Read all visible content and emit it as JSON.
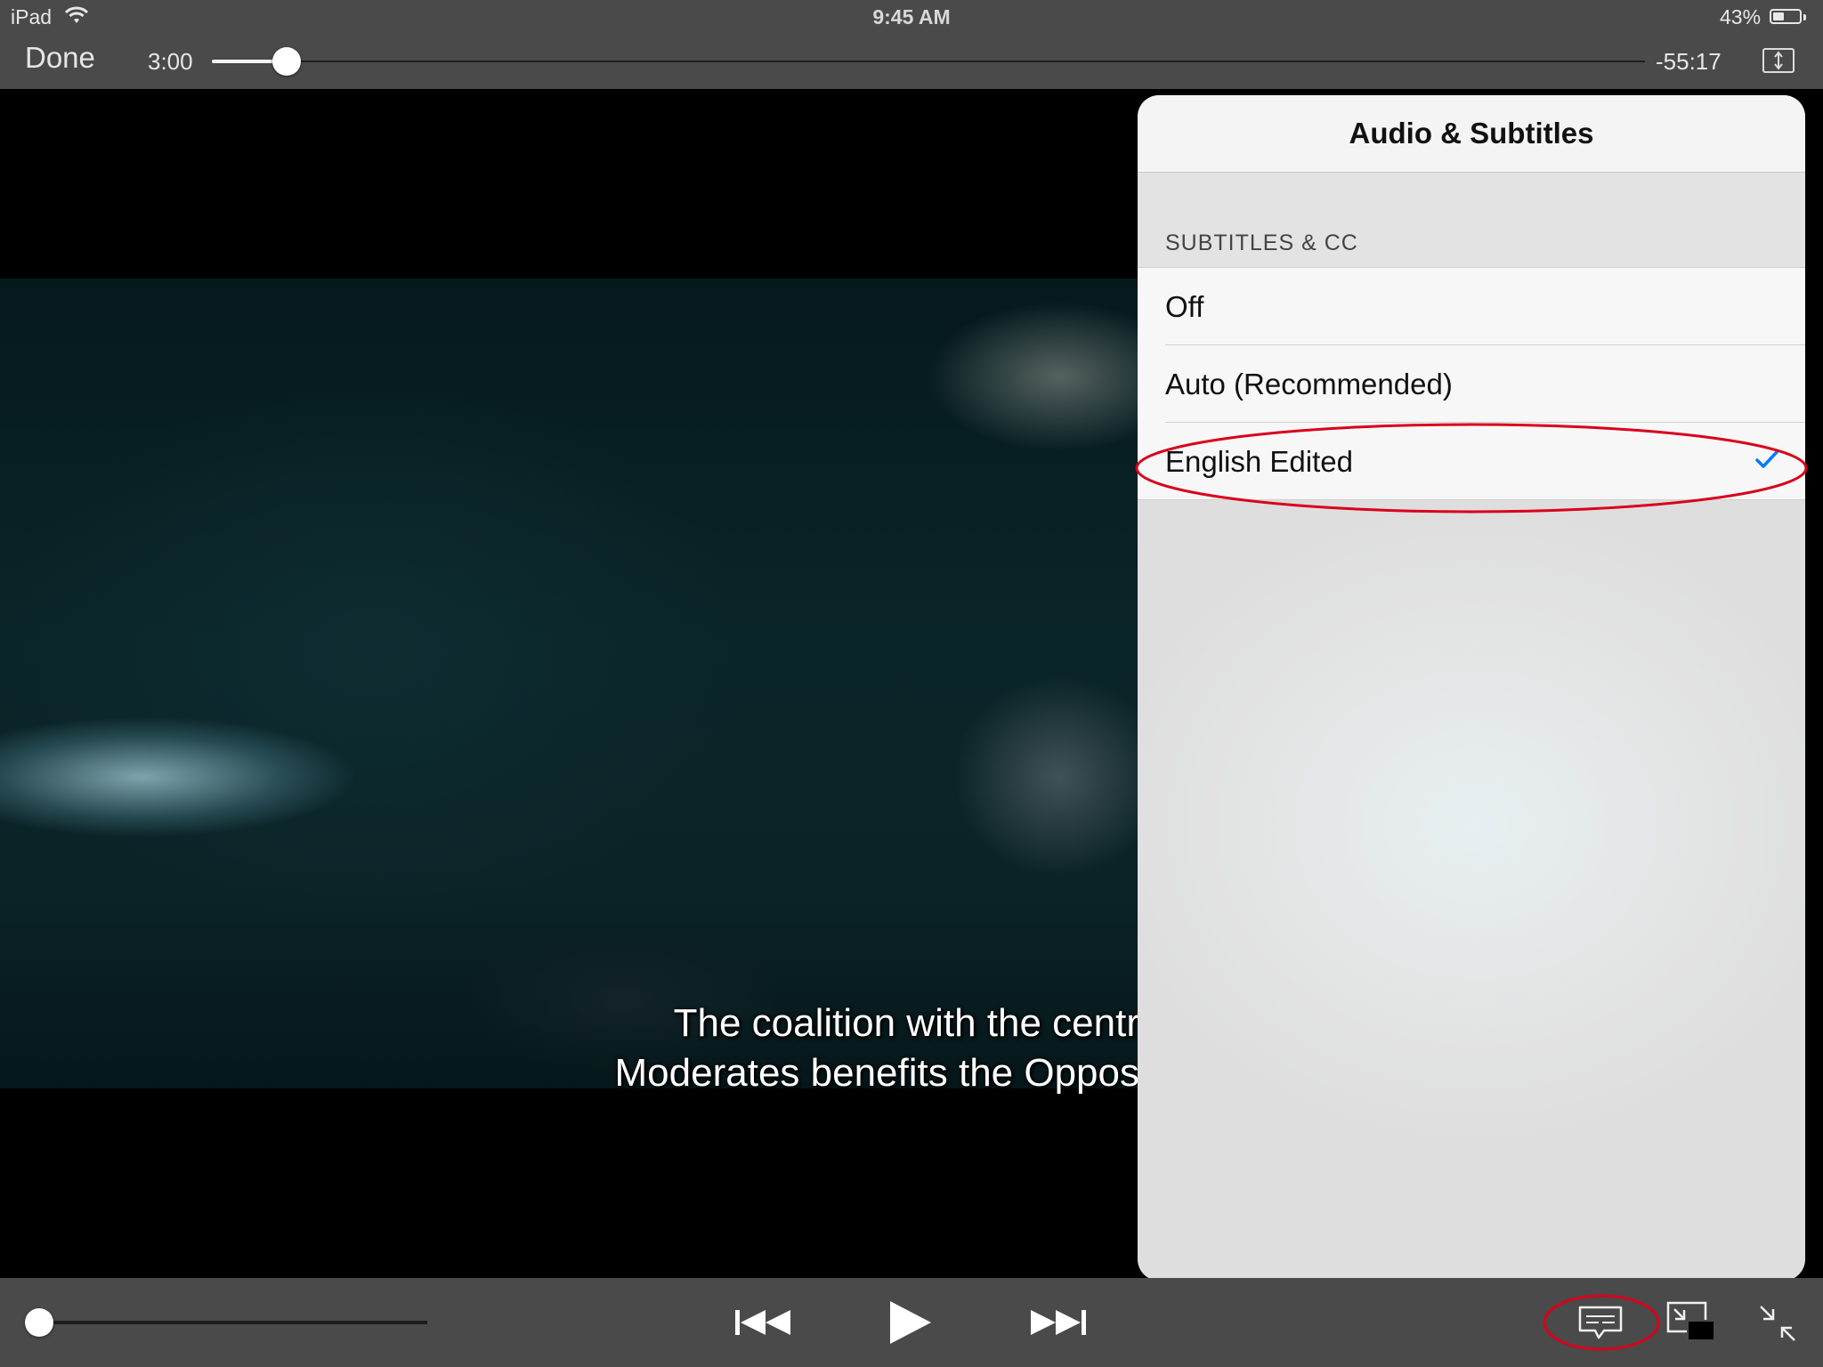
{
  "status_bar": {
    "device": "iPad",
    "time": "9:45 AM",
    "battery_percent": "43%",
    "battery_level": 0.43
  },
  "player": {
    "done_label": "Done",
    "elapsed": "3:00",
    "remaining": "-55:17",
    "progress": 0.052,
    "volume": 0.0,
    "subtitle_lines": [
      "The coalition with the centr",
      "Moderates benefits the Oppos"
    ]
  },
  "popover": {
    "title": "Audio & Subtitles",
    "section_header": "SUBTITLES & CC",
    "options": [
      {
        "label": "Off",
        "selected": false
      },
      {
        "label": "Auto (Recommended)",
        "selected": false
      },
      {
        "label": "English Edited",
        "selected": true
      }
    ],
    "accent_color": "#007aff"
  },
  "controls": {
    "icons": [
      "skip-back-icon",
      "play-icon",
      "skip-forward-icon",
      "subtitles-icon",
      "picture-in-picture-icon",
      "exit-fullscreen-icon"
    ]
  },
  "annotation": {
    "color": "#d9001b"
  }
}
